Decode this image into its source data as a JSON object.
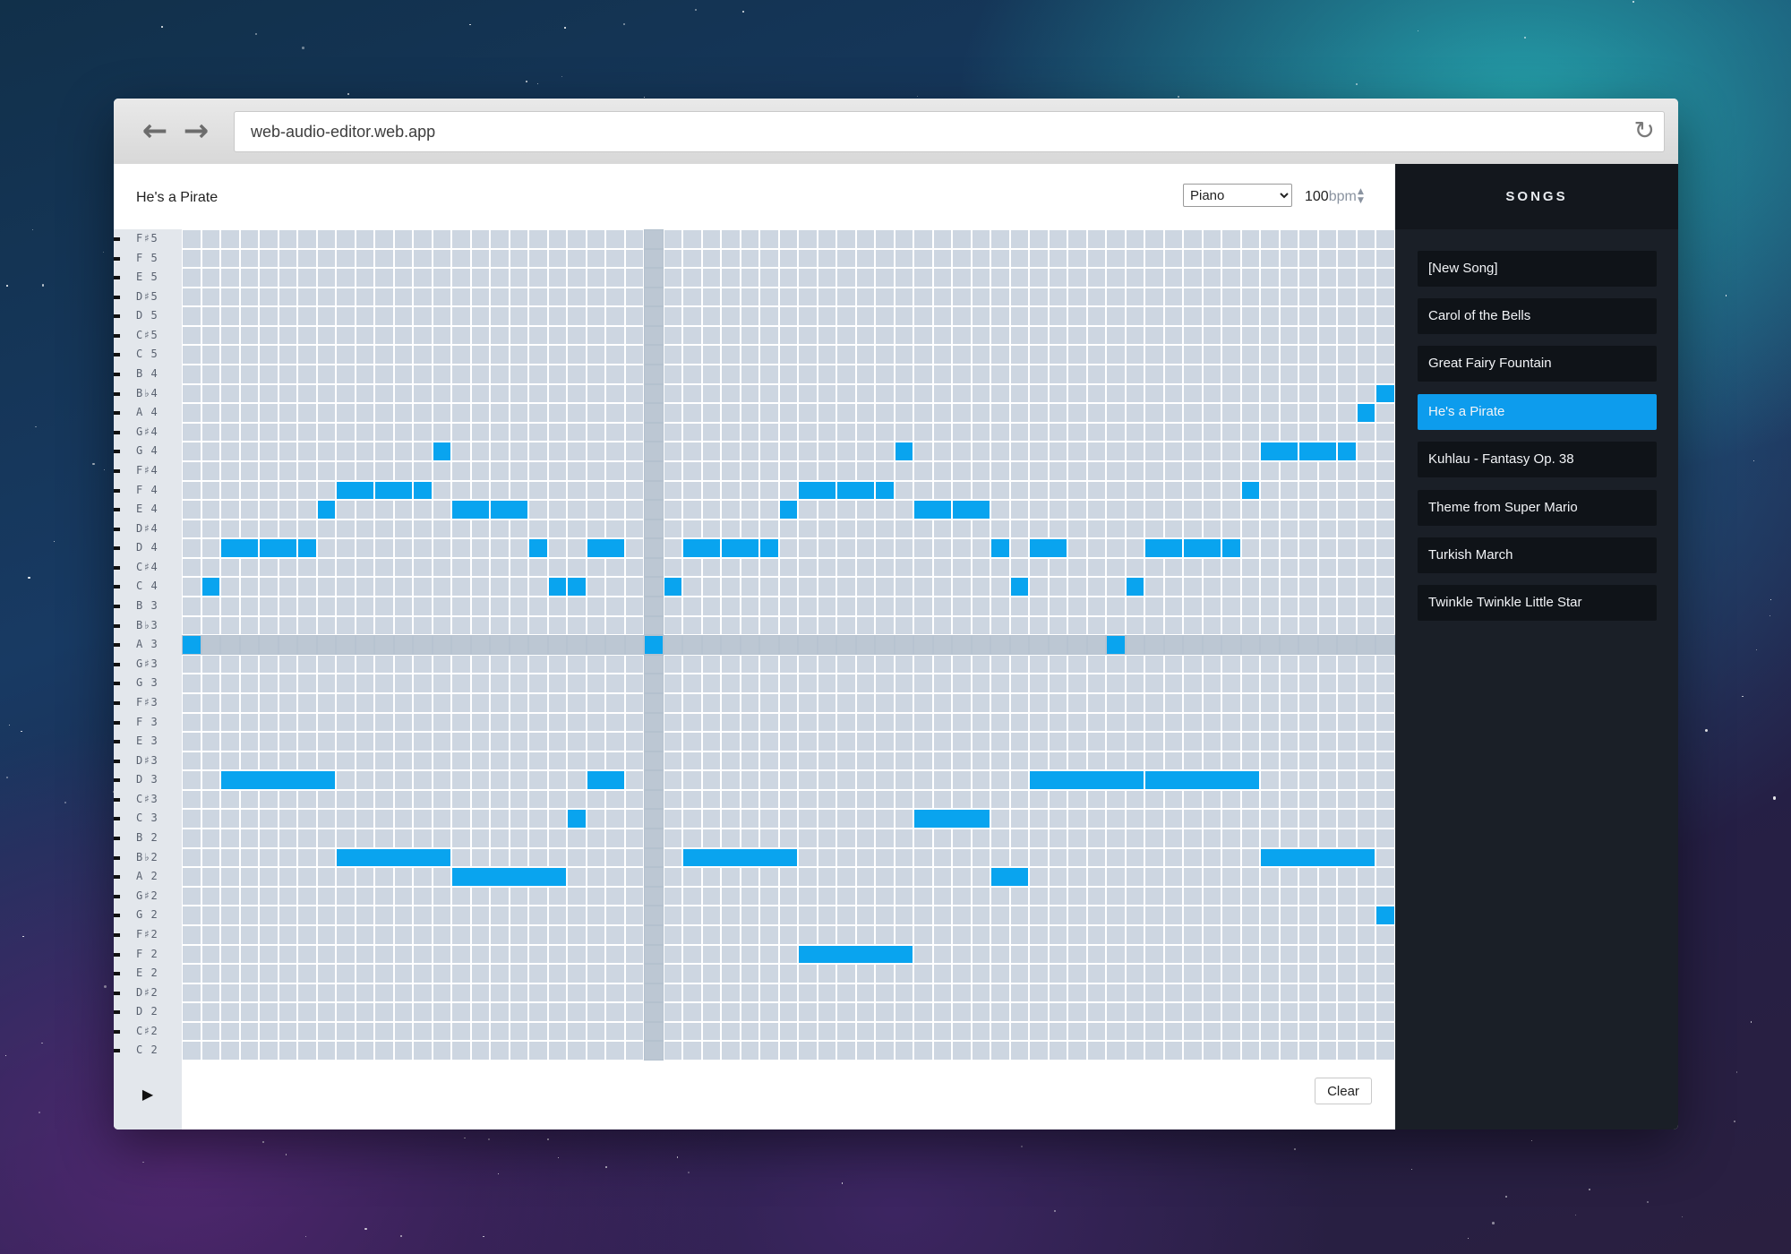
{
  "browser": {
    "url": "web-audio-editor.web.app",
    "back_icon": "←",
    "forward_icon": "→",
    "reload_icon": "↻"
  },
  "editor": {
    "song_title": "He's a Pirate",
    "instrument": "Piano",
    "bpm_value": "100",
    "bpm_unit": "bpm",
    "play_icon": "▶",
    "clear_label": "Clear",
    "note_color": "#09a4ef",
    "cell_color": "#cdd6e1"
  },
  "grid": {
    "pitches": [
      "F♯5",
      "F 5",
      "E 5",
      "D♯5",
      "D 5",
      "C♯5",
      "C 5",
      "B 4",
      "B♭4",
      "A 4",
      "G♯4",
      "G 4",
      "F♯4",
      "F 4",
      "E 4",
      "D♯4",
      "D 4",
      "C♯4",
      "C 4",
      "B 3",
      "B♭3",
      "A 3",
      "G♯3",
      "G 3",
      "F♯3",
      "F 3",
      "E 3",
      "D♯3",
      "D 3",
      "C♯3",
      "C 3",
      "B 2",
      "B♭2",
      "A 2",
      "G♯2",
      "G 2",
      "F♯2",
      "F 2",
      "E 2",
      "D♯2",
      "D 2",
      "C♯2",
      "C 2"
    ],
    "steps": 63,
    "highlight_pitch": "A 3",
    "highlight_step": 24,
    "notes": [
      {
        "pitch": "A 3",
        "start": 0,
        "length": 1
      },
      {
        "pitch": "C 4",
        "start": 1,
        "length": 1
      },
      {
        "pitch": "D 4",
        "start": 2,
        "length": 2
      },
      {
        "pitch": "D 4",
        "start": 4,
        "length": 2
      },
      {
        "pitch": "D 4",
        "start": 6,
        "length": 1
      },
      {
        "pitch": "E 4",
        "start": 7,
        "length": 1
      },
      {
        "pitch": "F 4",
        "start": 8,
        "length": 2
      },
      {
        "pitch": "F 4",
        "start": 10,
        "length": 2
      },
      {
        "pitch": "F 4",
        "start": 12,
        "length": 1
      },
      {
        "pitch": "G 4",
        "start": 13,
        "length": 1
      },
      {
        "pitch": "E 4",
        "start": 14,
        "length": 2
      },
      {
        "pitch": "E 4",
        "start": 16,
        "length": 2
      },
      {
        "pitch": "D 4",
        "start": 18,
        "length": 1
      },
      {
        "pitch": "C 4",
        "start": 19,
        "length": 1
      },
      {
        "pitch": "C 4",
        "start": 20,
        "length": 1
      },
      {
        "pitch": "D 4",
        "start": 21,
        "length": 2
      },
      {
        "pitch": "A 3",
        "start": 24,
        "length": 1
      },
      {
        "pitch": "C 4",
        "start": 25,
        "length": 1
      },
      {
        "pitch": "D 4",
        "start": 26,
        "length": 2
      },
      {
        "pitch": "D 4",
        "start": 28,
        "length": 2
      },
      {
        "pitch": "D 4",
        "start": 30,
        "length": 1
      },
      {
        "pitch": "E 4",
        "start": 31,
        "length": 1
      },
      {
        "pitch": "F 4",
        "start": 32,
        "length": 2
      },
      {
        "pitch": "F 4",
        "start": 34,
        "length": 2
      },
      {
        "pitch": "F 4",
        "start": 36,
        "length": 1
      },
      {
        "pitch": "G 4",
        "start": 37,
        "length": 1
      },
      {
        "pitch": "E 4",
        "start": 38,
        "length": 2
      },
      {
        "pitch": "E 4",
        "start": 40,
        "length": 2
      },
      {
        "pitch": "D 4",
        "start": 42,
        "length": 1
      },
      {
        "pitch": "C 4",
        "start": 43,
        "length": 1
      },
      {
        "pitch": "D 4",
        "start": 44,
        "length": 2
      },
      {
        "pitch": "A 3",
        "start": 48,
        "length": 1
      },
      {
        "pitch": "C 4",
        "start": 49,
        "length": 1
      },
      {
        "pitch": "D 4",
        "start": 50,
        "length": 2
      },
      {
        "pitch": "D 4",
        "start": 52,
        "length": 2
      },
      {
        "pitch": "D 4",
        "start": 54,
        "length": 1
      },
      {
        "pitch": "F 4",
        "start": 55,
        "length": 1
      },
      {
        "pitch": "G 4",
        "start": 56,
        "length": 2
      },
      {
        "pitch": "G 4",
        "start": 58,
        "length": 2
      },
      {
        "pitch": "G 4",
        "start": 60,
        "length": 1
      },
      {
        "pitch": "A 4",
        "start": 61,
        "length": 1
      },
      {
        "pitch": "B♭4",
        "start": 62,
        "length": 1
      },
      {
        "pitch": "D 3",
        "start": 2,
        "length": 6
      },
      {
        "pitch": "B♭2",
        "start": 8,
        "length": 6
      },
      {
        "pitch": "A 2",
        "start": 14,
        "length": 6
      },
      {
        "pitch": "C 3",
        "start": 20,
        "length": 1
      },
      {
        "pitch": "D 3",
        "start": 21,
        "length": 2
      },
      {
        "pitch": "B♭2",
        "start": 26,
        "length": 6
      },
      {
        "pitch": "F 2",
        "start": 32,
        "length": 6
      },
      {
        "pitch": "C 3",
        "start": 38,
        "length": 4
      },
      {
        "pitch": "A 2",
        "start": 42,
        "length": 2
      },
      {
        "pitch": "D 3",
        "start": 44,
        "length": 6
      },
      {
        "pitch": "D 3",
        "start": 50,
        "length": 6
      },
      {
        "pitch": "B♭2",
        "start": 56,
        "length": 6
      },
      {
        "pitch": "G 2",
        "start": 62,
        "length": 1
      }
    ]
  },
  "sidebar": {
    "title": "SONGS",
    "items": [
      {
        "label": "[New Song]",
        "active": false
      },
      {
        "label": "Carol of the Bells",
        "active": false
      },
      {
        "label": "Great Fairy Fountain",
        "active": false
      },
      {
        "label": "He's a Pirate",
        "active": true
      },
      {
        "label": "Kuhlau - Fantasy Op. 38",
        "active": false
      },
      {
        "label": "Theme from Super Mario",
        "active": false
      },
      {
        "label": "Turkish March",
        "active": false
      },
      {
        "label": "Twinkle Twinkle Little Star",
        "active": false
      }
    ]
  }
}
